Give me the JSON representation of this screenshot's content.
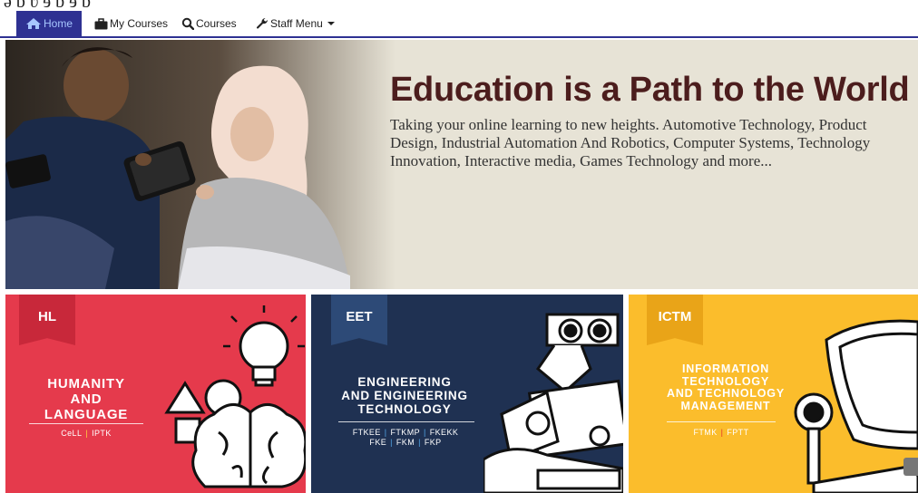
{
  "nav": {
    "items": [
      {
        "label": "Home",
        "icon": "home-icon",
        "active": true
      },
      {
        "label": "My Courses",
        "icon": "briefcase-icon",
        "active": false
      },
      {
        "label": "Courses",
        "icon": "search-icon",
        "active": false
      },
      {
        "label": "Staff Menu",
        "icon": "wrench-icon",
        "active": false
      }
    ],
    "accent": "#2e3192"
  },
  "hero": {
    "title": "Education is a Path to the World",
    "description": "Taking your online learning to new heights. Automotive Technology, Product Design, Industrial Automation And Robotics, Computer Systems, Technology Innovation, Interactive media, Games Technology and more...",
    "background": "#e7e3d6",
    "title_color": "#4c1d1d"
  },
  "cards": [
    {
      "badge": "HL",
      "title": "HUMANITY\nAND\nLANGUAGE",
      "faculties": [
        "CeLL",
        "IPTK"
      ],
      "color": "#e53a4c",
      "illustration": "lightbulb-brain-shapes-icon"
    },
    {
      "badge": "EET",
      "title": "ENGINEERING\nAND ENGINEERING\nTECHNOLOGY",
      "faculties_row1": [
        "FTKEE",
        "FTKMP",
        "FKEKK"
      ],
      "faculties_row2": [
        "FKE",
        "FKM",
        "FKP"
      ],
      "color": "#1f3152",
      "illustration": "robot-icon"
    },
    {
      "badge": "ICTM",
      "title": "INFORMATION\nTECHNOLOGY\nAND TECHNOLOGY\nMANAGEMENT",
      "faculties": [
        "FTMK",
        "FPTT"
      ],
      "color": "#fbbd2c",
      "illustration": "monitor-robot-arm-icon"
    }
  ]
}
